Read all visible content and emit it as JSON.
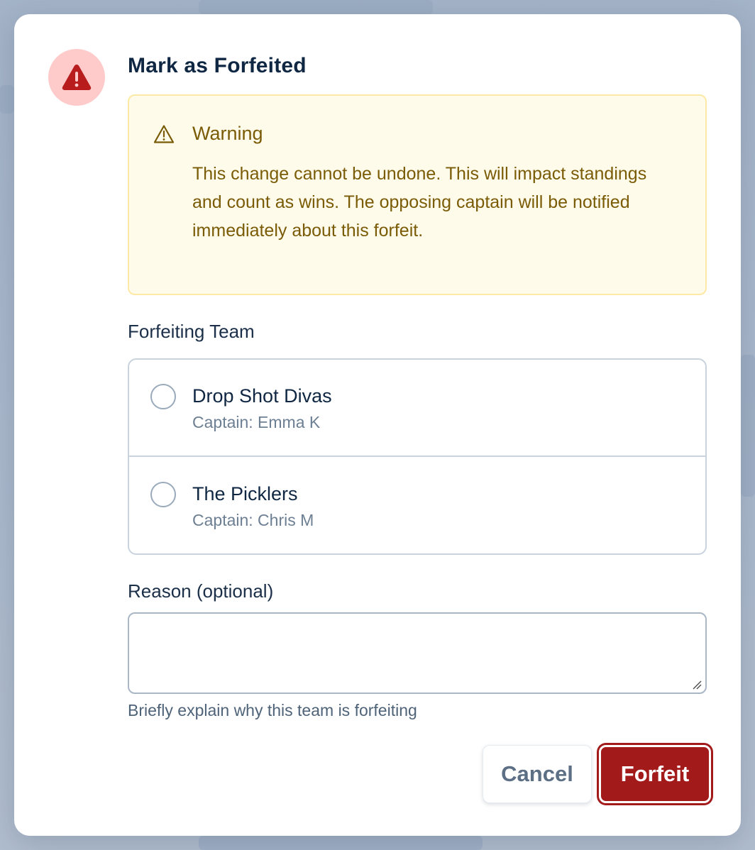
{
  "dialog": {
    "title": "Mark as Forfeited"
  },
  "warning": {
    "title": "Warning",
    "message": "This change cannot be undone. This will impact standings and count as wins. The opposing captain will be notified immediately about this forfeit."
  },
  "team_section": {
    "label": "Forfeiting Team",
    "teams": [
      {
        "name": "Drop Shot Divas",
        "captain": "Captain: Emma K"
      },
      {
        "name": "The Picklers",
        "captain": "Captain: Chris M"
      }
    ]
  },
  "reason": {
    "label": "Reason (optional)",
    "value": "",
    "placeholder": "",
    "helper": "Briefly explain why this team is forfeiting"
  },
  "actions": {
    "cancel_label": "Cancel",
    "forfeit_label": "Forfeit"
  },
  "colors": {
    "danger": "#a31a1a",
    "warning_bg": "#fffbea",
    "warning_text": "#7a5b06"
  },
  "icons": {
    "header": "alert-triangle-icon",
    "warning": "warning-triangle-icon"
  }
}
